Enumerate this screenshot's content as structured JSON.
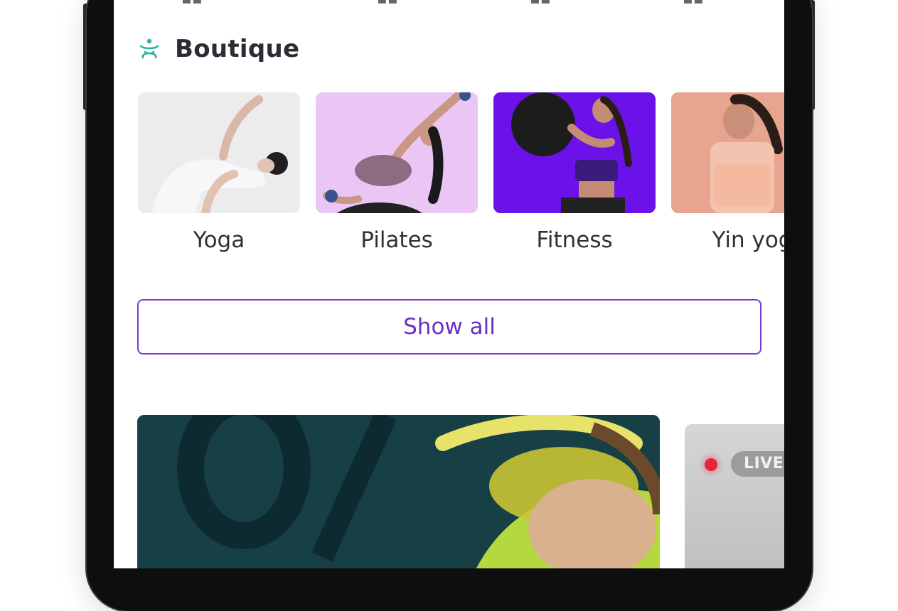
{
  "section": {
    "title": "Boutique",
    "icon": "lotus-icon",
    "accent_color": "#2bb3a3"
  },
  "categories": [
    {
      "label": "Yoga",
      "bg": "#ececec"
    },
    {
      "label": "Pilates",
      "bg": "#e9c6f4"
    },
    {
      "label": "Fitness",
      "bg": "#6a12e8"
    },
    {
      "label": "Yin yog",
      "bg": "#e7a48e"
    }
  ],
  "show_all_label": "Show all",
  "show_all_color": "#7a3fc8",
  "live_badge": "LIVE",
  "live_color": "#e8263a"
}
